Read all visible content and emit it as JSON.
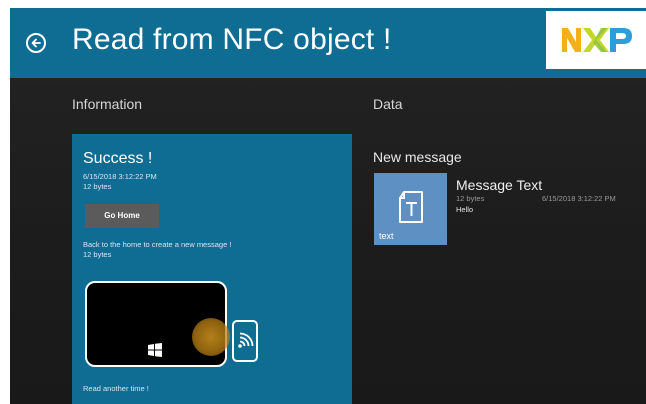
{
  "header": {
    "title": "Read from NFC object !",
    "logo": "NXP",
    "back_icon": "arrow-left-circle-icon"
  },
  "colors": {
    "header": "#0f6c93",
    "panel": "#0f6c93",
    "button": "#5b5b5b",
    "tile": "#5e90c3",
    "logo_yellow": "#f2b11a",
    "logo_green": "#c4d62d",
    "logo_blue": "#2c9fd9"
  },
  "information": {
    "title": "Information",
    "status": "Success !",
    "date": "6/15/2018 3:12:22 PM",
    "size": "12 bytes",
    "home_button": "Go Home",
    "back_text": "Back to the home to create a new message !",
    "back_size": "12 bytes",
    "read_again": "Read another time !"
  },
  "data": {
    "title": "Data",
    "new_message": "New message",
    "message": {
      "type_label": "text",
      "title": "Message Text",
      "size": "12 bytes",
      "date": "6/15/2018 3:12:22 PM",
      "content": "Hello"
    }
  }
}
